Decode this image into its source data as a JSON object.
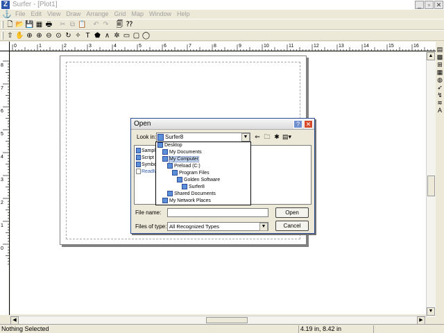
{
  "window": {
    "title": "Surfer - [Plot1]",
    "app_icon": "Z",
    "buttons": [
      "minimize",
      "maximize",
      "close"
    ]
  },
  "menu": {
    "items": [
      "File",
      "Edit",
      "View",
      "Draw",
      "Arrange",
      "Grid",
      "Map",
      "Window",
      "Help"
    ]
  },
  "ruler": {
    "h_ticks": [
      "0",
      "1",
      "2",
      "3",
      "4",
      "5",
      "6",
      "7",
      "8",
      "9",
      "10",
      "11",
      "12",
      "13",
      "14",
      "15",
      "16"
    ],
    "v_ticks": [
      "8",
      "7",
      "6",
      "5",
      "4",
      "3",
      "2",
      "1",
      "0"
    ]
  },
  "dialog": {
    "title": "Open",
    "help_label": "?",
    "close_label": "✕",
    "look_in_label": "Look in:",
    "look_in_value": "Surfer8",
    "file_name_label": "File name:",
    "file_name_value": "",
    "files_of_type_label": "Files of type:",
    "files_of_type_value": "All Recognized Types",
    "open_label": "Open",
    "cancel_label": "Cancel",
    "files": [
      {
        "name": "Sampl",
        "type": "folder"
      },
      {
        "name": "Script",
        "type": "folder"
      },
      {
        "name": "Symbo",
        "type": "folder"
      },
      {
        "name": "ReadM",
        "type": "doc"
      }
    ],
    "tree": [
      {
        "name": "Desktop",
        "indent": 0
      },
      {
        "name": "My Documents",
        "indent": 1
      },
      {
        "name": "My Computer",
        "indent": 1,
        "selected": true
      },
      {
        "name": "Preload (C:)",
        "indent": 2
      },
      {
        "name": "Program Files",
        "indent": 3
      },
      {
        "name": "Golden Software",
        "indent": 4
      },
      {
        "name": "Surfer8",
        "indent": 5
      },
      {
        "name": "Shared Documents",
        "indent": 2
      },
      {
        "name": "My Network Places",
        "indent": 1
      }
    ]
  },
  "status": {
    "left": "Nothing Selected",
    "coords": "4.19 in, 8.42 in"
  },
  "colors": {
    "chrome": "#ece9d8",
    "titlebar_accent": "#2a55a8",
    "dialog_close": "#d44a2a",
    "selection": "#c6d8f4"
  }
}
